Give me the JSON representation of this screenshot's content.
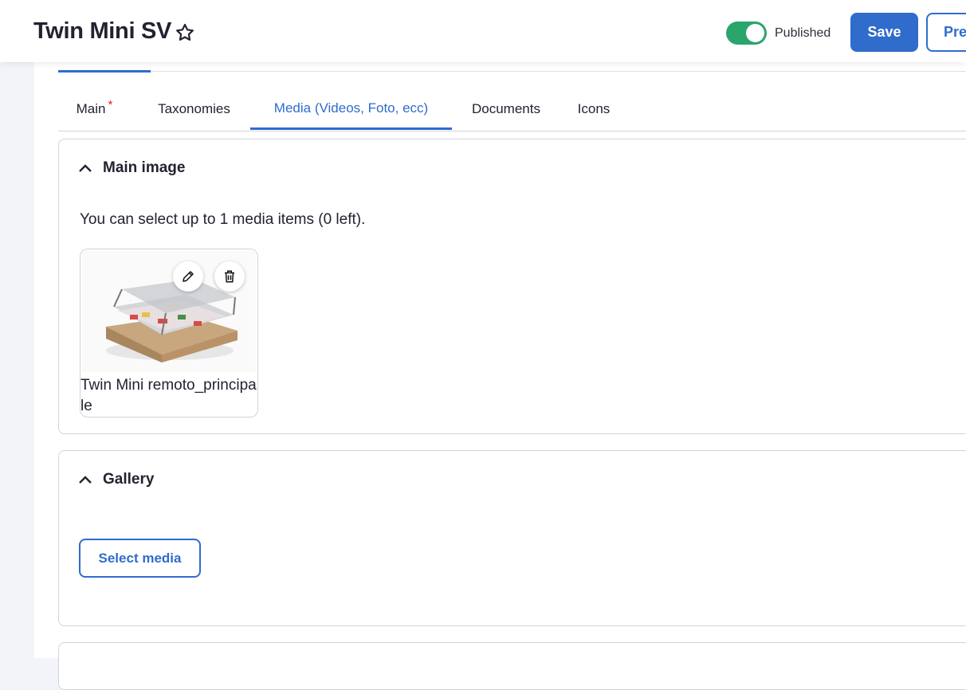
{
  "header": {
    "title": "Twin Mini SV",
    "status_label": "Published",
    "save_label": "Save",
    "preview_label": "Pre"
  },
  "tabs": [
    {
      "label": "Main",
      "required_mark": "*"
    },
    {
      "label": "Taxonomies"
    },
    {
      "label": "Media (Videos, Foto, ecc)",
      "active": true
    },
    {
      "label": "Documents"
    },
    {
      "label": "Icons"
    }
  ],
  "sections": {
    "main_image": {
      "title": "Main image",
      "help_text": "You can select up to 1 media items (0 left).",
      "media": {
        "name": "Twin Mini remoto_principale"
      }
    },
    "gallery": {
      "title": "Gallery",
      "select_label": "Select media"
    }
  },
  "colors": {
    "accent": "#2f6ccc",
    "toggle_on": "#2aa56b",
    "required": "#d72222"
  }
}
